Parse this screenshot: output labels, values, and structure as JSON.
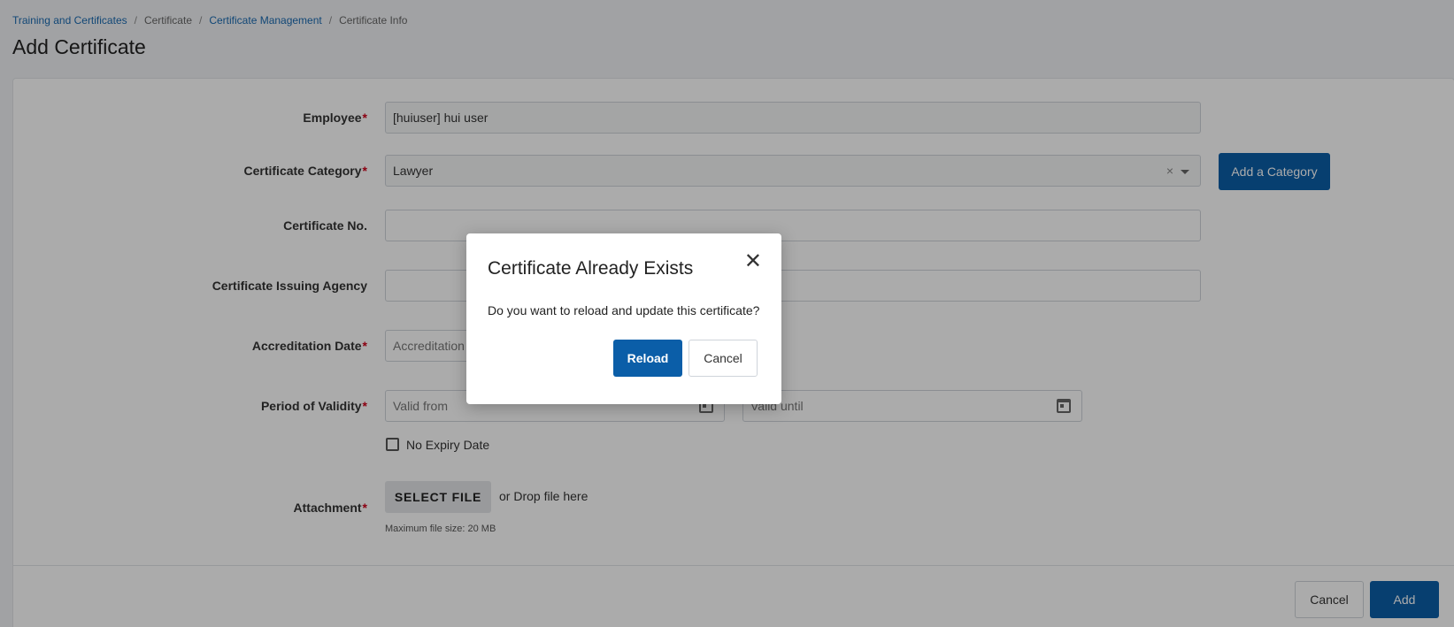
{
  "breadcrumb": {
    "items": [
      {
        "label": "Training and Certificates",
        "link": true
      },
      {
        "label": "Certificate",
        "link": false
      },
      {
        "label": "Certificate Management",
        "link": true
      },
      {
        "label": "Certificate Info",
        "link": false
      }
    ],
    "separator": "/"
  },
  "page_title": "Add Certificate",
  "form": {
    "employee": {
      "label": "Employee",
      "value": "[huiuser]  hui user"
    },
    "category": {
      "label": "Certificate Category",
      "value": "Lawyer",
      "clear": "×",
      "add_button": "Add a Category"
    },
    "cert_no": {
      "label": "Certificate No.",
      "value": ""
    },
    "issuing_agency": {
      "label": "Certificate Issuing Agency",
      "value": ""
    },
    "accreditation_date": {
      "label": "Accreditation Date",
      "placeholder": "Accreditation"
    },
    "validity": {
      "label": "Period of Validity",
      "from_placeholder": "Valid from",
      "until_placeholder": "Valid until"
    },
    "no_expiry": {
      "label": "No Expiry Date",
      "checked": false
    },
    "attachment": {
      "label": "Attachment",
      "button": "SELECT FILE",
      "drop_text": "or Drop file here",
      "hint": "Maximum file size: 20 MB"
    },
    "required_mark": "*"
  },
  "footer": {
    "cancel": "Cancel",
    "add": "Add"
  },
  "modal": {
    "title": "Certificate Already Exists",
    "message": "Do you want to reload and update this certificate?",
    "reload": "Reload",
    "cancel": "Cancel",
    "close_icon": "close-icon"
  },
  "colors": {
    "primary": "#0b5ea8",
    "link": "#1a6ab1",
    "required": "#d0021b"
  }
}
